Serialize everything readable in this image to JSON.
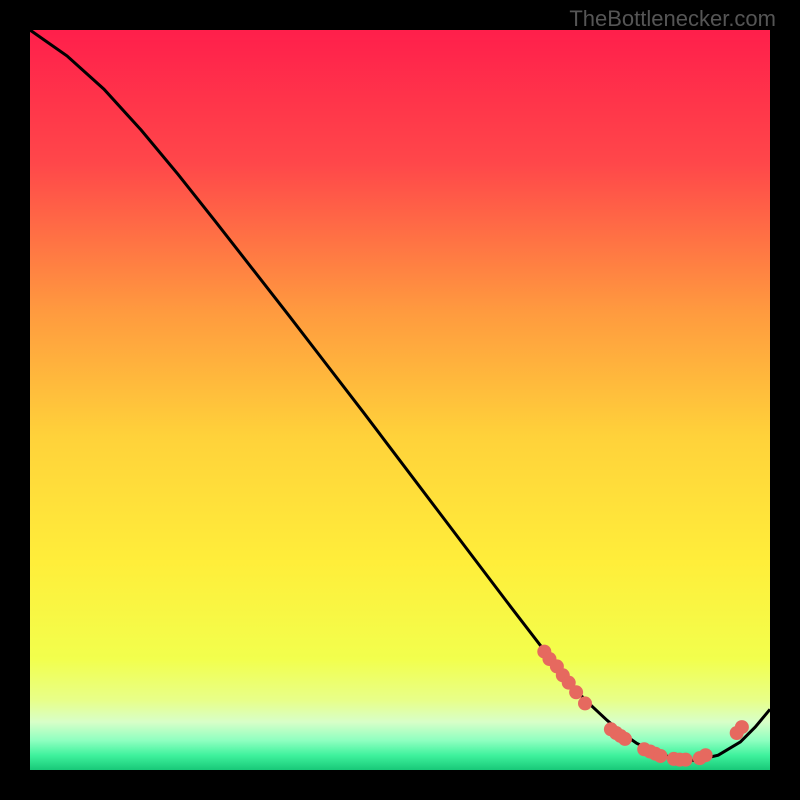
{
  "watermark": "TheBottlenecker.com",
  "chart_data": {
    "type": "line",
    "title": "",
    "xlabel": "",
    "ylabel": "",
    "xlim": [
      0,
      1
    ],
    "ylim": [
      0,
      1
    ],
    "series": [
      {
        "name": "curve",
        "x": [
          0.0,
          0.05,
          0.1,
          0.15,
          0.2,
          0.25,
          0.3,
          0.35,
          0.4,
          0.45,
          0.5,
          0.55,
          0.6,
          0.65,
          0.7,
          0.72,
          0.75,
          0.78,
          0.8,
          0.82,
          0.85,
          0.88,
          0.9,
          0.93,
          0.96,
          0.98,
          1.0
        ],
        "y": [
          1.0,
          0.965,
          0.92,
          0.865,
          0.805,
          0.742,
          0.678,
          0.614,
          0.549,
          0.484,
          0.418,
          0.352,
          0.286,
          0.22,
          0.155,
          0.128,
          0.095,
          0.067,
          0.05,
          0.036,
          0.022,
          0.013,
          0.013,
          0.02,
          0.038,
          0.058,
          0.082
        ]
      }
    ],
    "markers": [
      {
        "x": 0.695,
        "y": 0.16
      },
      {
        "x": 0.702,
        "y": 0.15
      },
      {
        "x": 0.712,
        "y": 0.14
      },
      {
        "x": 0.72,
        "y": 0.128
      },
      {
        "x": 0.728,
        "y": 0.118
      },
      {
        "x": 0.738,
        "y": 0.105
      },
      {
        "x": 0.75,
        "y": 0.09
      },
      {
        "x": 0.785,
        "y": 0.055
      },
      {
        "x": 0.792,
        "y": 0.05
      },
      {
        "x": 0.798,
        "y": 0.046
      },
      {
        "x": 0.804,
        "y": 0.042
      },
      {
        "x": 0.83,
        "y": 0.028
      },
      {
        "x": 0.838,
        "y": 0.025
      },
      {
        "x": 0.845,
        "y": 0.022
      },
      {
        "x": 0.852,
        "y": 0.019
      },
      {
        "x": 0.87,
        "y": 0.015
      },
      {
        "x": 0.878,
        "y": 0.014
      },
      {
        "x": 0.886,
        "y": 0.014
      },
      {
        "x": 0.905,
        "y": 0.016
      },
      {
        "x": 0.913,
        "y": 0.02
      },
      {
        "x": 0.955,
        "y": 0.05
      },
      {
        "x": 0.962,
        "y": 0.058
      }
    ],
    "gradient_stops": [
      {
        "offset": 0.0,
        "color": "#ff1f4b"
      },
      {
        "offset": 0.18,
        "color": "#ff474a"
      },
      {
        "offset": 0.38,
        "color": "#ff9a3f"
      },
      {
        "offset": 0.55,
        "color": "#ffd23a"
      },
      {
        "offset": 0.72,
        "color": "#ffee3a"
      },
      {
        "offset": 0.85,
        "color": "#f2ff4d"
      },
      {
        "offset": 0.905,
        "color": "#e8ff88"
      },
      {
        "offset": 0.935,
        "color": "#d8ffc8"
      },
      {
        "offset": 0.96,
        "color": "#8fffc0"
      },
      {
        "offset": 0.98,
        "color": "#3ff29d"
      },
      {
        "offset": 1.0,
        "color": "#18c878"
      }
    ],
    "marker_color": "#e6695f",
    "line_color": "#000000"
  }
}
